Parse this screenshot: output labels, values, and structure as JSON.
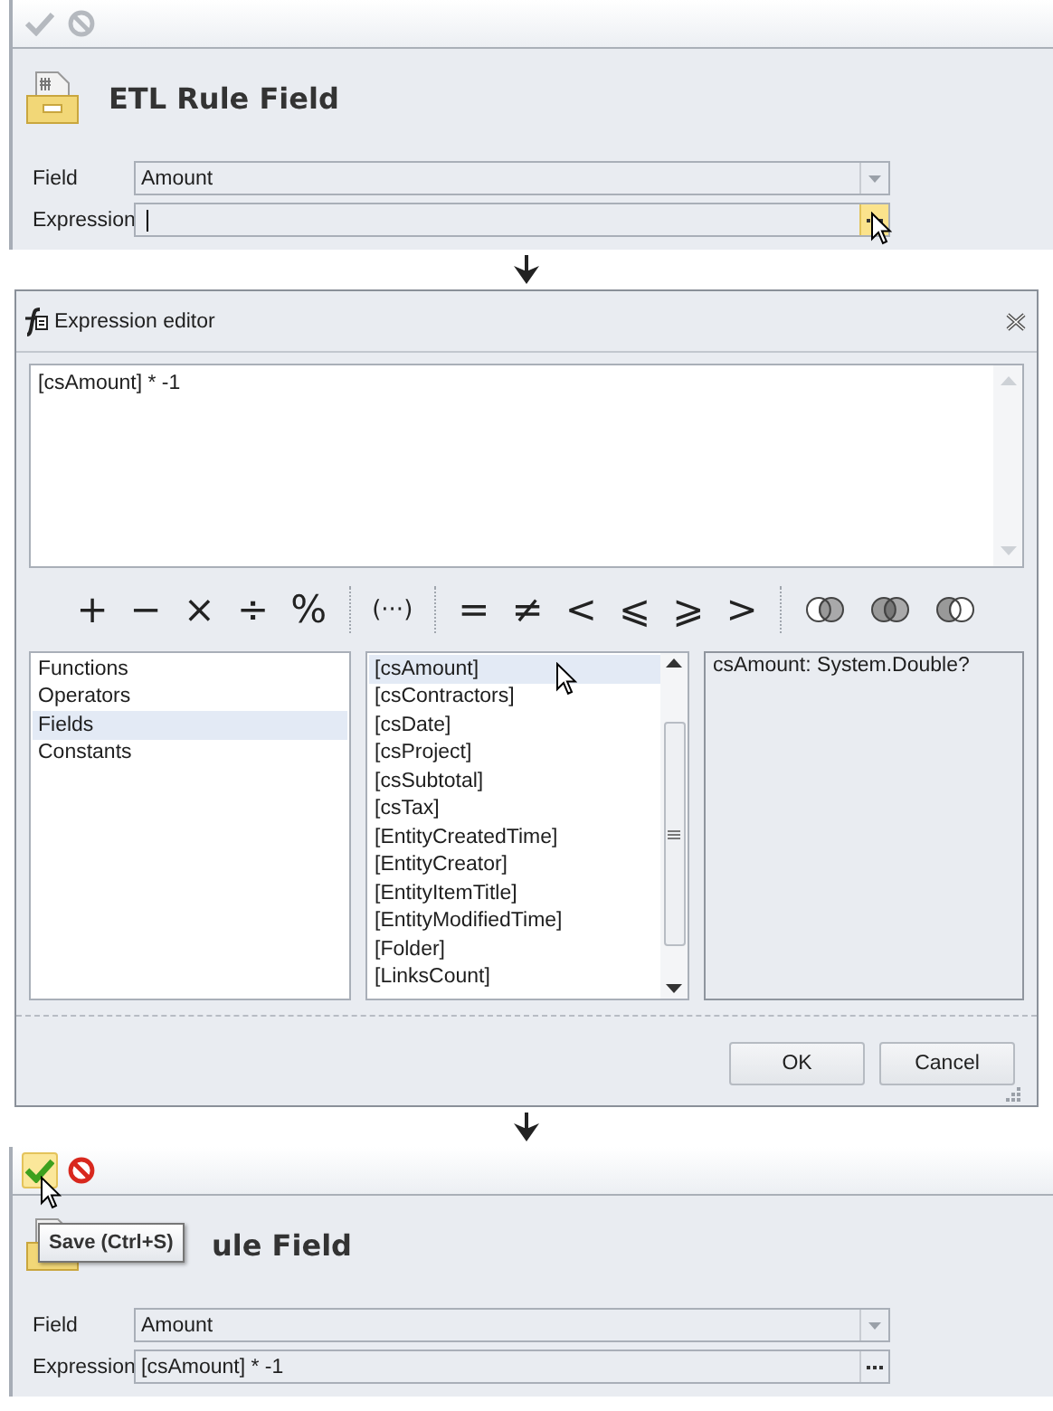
{
  "panels": [
    {
      "toolbar": [
        {
          "kind": "save",
          "disabled": true,
          "hovered": false
        },
        {
          "kind": "cancel",
          "disabled": true,
          "hovered": false
        }
      ],
      "title": "ETL Rule Field",
      "fields": [
        {
          "label": "Field",
          "value": "Amount",
          "kind": "dropdown",
          "focused": false,
          "button_highlighted": false
        },
        {
          "label": "Expression",
          "kind": "ellipsis",
          "focused": true,
          "button_highlighted": true,
          "pointer_over": true
        }
      ]
    },
    {
      "toolbar": [
        {
          "kind": "save",
          "disabled": false,
          "hovered": true,
          "pointer_over": true
        },
        {
          "kind": "cancel",
          "disabled": false,
          "hovered": false
        }
      ],
      "title": "ule Field",
      "tooltip": "Save (Ctrl+S)",
      "fields": [
        {
          "label": "Field",
          "value": "Amount",
          "kind": "dropdown",
          "focused": false,
          "button_highlighted": false
        },
        {
          "label": "Expression",
          "value": "[csAmount] * -1",
          "kind": "ellipsis",
          "focused": false,
          "button_highlighted": false
        }
      ]
    }
  ],
  "dialog": {
    "title": "Expression editor",
    "expression": "[csAmount] * -1",
    "operator_groups": [
      [
        "+",
        "−",
        "×",
        "÷",
        "%"
      ],
      [
        "(···)"
      ],
      [
        "=",
        "≠",
        "<",
        "⩽",
        "⩾",
        ">"
      ]
    ],
    "categories": [
      {
        "label": "Functions",
        "selected": false
      },
      {
        "label": "Operators",
        "selected": false
      },
      {
        "label": "Fields",
        "selected": true
      },
      {
        "label": "Constants",
        "selected": false
      }
    ],
    "items": [
      {
        "label": "[csAmount]",
        "selected": true,
        "pointer_over": true
      },
      {
        "label": "[csContractors]",
        "selected": false
      },
      {
        "label": "[csDate]",
        "selected": false
      },
      {
        "label": "[csProject]",
        "selected": false
      },
      {
        "label": "[csSubtotal]",
        "selected": false
      },
      {
        "label": "[csTax]",
        "selected": false
      },
      {
        "label": "[EntityCreatedTime]",
        "selected": false
      },
      {
        "label": "[EntityCreator]",
        "selected": false
      },
      {
        "label": "[EntityItemTitle]",
        "selected": false
      },
      {
        "label": "[EntityModifiedTime]",
        "selected": false
      },
      {
        "label": "[Folder]",
        "selected": false
      },
      {
        "label": "[LinksCount]",
        "selected": false
      }
    ],
    "description": "csAmount: System.Double?",
    "buttons": [
      "OK",
      "Cancel"
    ]
  }
}
